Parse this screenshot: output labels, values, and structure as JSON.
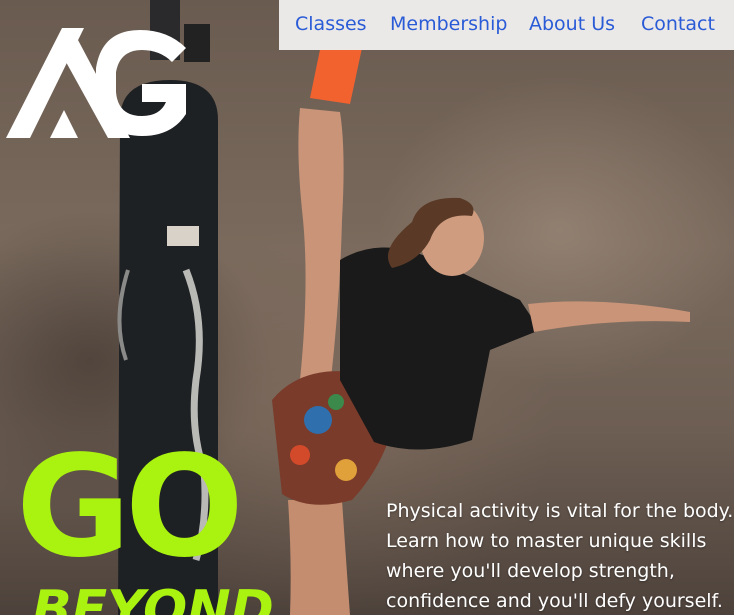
{
  "brand": {
    "logo_text": "AG",
    "logo_color": "#ffffff"
  },
  "nav": {
    "background": "#ebe9e7",
    "link_color": "#2a5bd7",
    "items": [
      {
        "label": "Classes"
      },
      {
        "label": "Membership"
      },
      {
        "label": "About Us"
      },
      {
        "label": "Contact"
      }
    ]
  },
  "hero": {
    "headline_line1": "GO",
    "headline_line2": "BEYOND",
    "headline_color": "#aaf20f",
    "intro_text": "Physical activity is vital for the body.\nLearn how to master unique skills\nwhere you'll develop strength,\nconfidence and you'll defy yourself."
  }
}
